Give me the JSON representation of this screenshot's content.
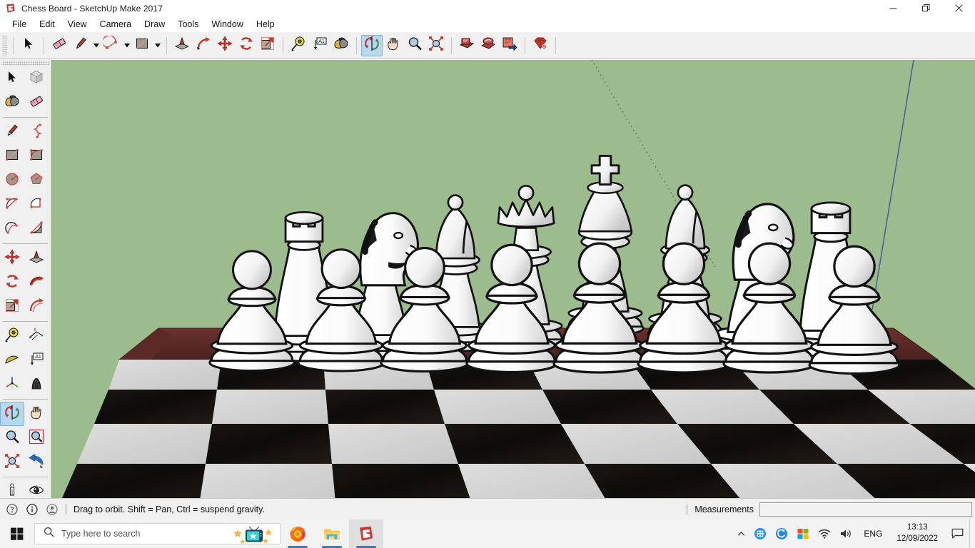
{
  "window": {
    "title": "Chess Board - SketchUp Make 2017",
    "app_icon": "sketchup-logo-icon",
    "controls": {
      "minimize": "─",
      "maximize": "❐",
      "close": "✕"
    }
  },
  "menubar": {
    "items": [
      {
        "label": "File"
      },
      {
        "label": "Edit"
      },
      {
        "label": "View"
      },
      {
        "label": "Camera"
      },
      {
        "label": "Draw"
      },
      {
        "label": "Tools"
      },
      {
        "label": "Window"
      },
      {
        "label": "Help"
      }
    ]
  },
  "toolbar_top": {
    "groups": [
      {
        "buttons": [
          {
            "name": "select-tool",
            "icon": "arrow-cursor-icon",
            "dropdown": false,
            "active": false
          }
        ]
      },
      {
        "buttons": [
          {
            "name": "eraser-tool",
            "icon": "eraser-icon",
            "dropdown": false,
            "active": false
          },
          {
            "name": "line-tool",
            "icon": "pencil-line-icon",
            "dropdown": true,
            "active": false
          },
          {
            "name": "arc-tool",
            "icon": "arc-icon",
            "dropdown": true,
            "active": false
          },
          {
            "name": "rectangle-tool",
            "icon": "rectangle-icon",
            "dropdown": true,
            "active": false
          }
        ]
      },
      {
        "buttons": [
          {
            "name": "pushpull-tool",
            "icon": "push-pull-icon",
            "dropdown": false,
            "active": false
          },
          {
            "name": "followme-tool",
            "icon": "follow-me-icon",
            "dropdown": false,
            "active": false
          },
          {
            "name": "move-tool",
            "icon": "move-arrows-icon",
            "dropdown": false,
            "active": false
          },
          {
            "name": "rotate-tool",
            "icon": "rotate-icon",
            "dropdown": false,
            "active": false
          },
          {
            "name": "scale-tool",
            "icon": "scale-icon",
            "dropdown": false,
            "active": false
          }
        ]
      },
      {
        "buttons": [
          {
            "name": "tape-measure-tool",
            "icon": "tape-measure-icon",
            "dropdown": false,
            "active": false
          },
          {
            "name": "text-tool",
            "icon": "text-label-icon",
            "dropdown": false,
            "active": false
          },
          {
            "name": "paint-bucket-tool",
            "icon": "paint-bucket-icon",
            "dropdown": false,
            "active": false
          }
        ]
      },
      {
        "buttons": [
          {
            "name": "orbit-tool",
            "icon": "orbit-icon",
            "dropdown": false,
            "active": true
          },
          {
            "name": "pan-tool",
            "icon": "hand-pan-icon",
            "dropdown": false,
            "active": false
          },
          {
            "name": "zoom-tool",
            "icon": "magnifier-zoom-icon",
            "dropdown": false,
            "active": false
          },
          {
            "name": "zoom-extents-tool",
            "icon": "zoom-extents-icon",
            "dropdown": false,
            "active": false
          }
        ]
      },
      {
        "buttons": [
          {
            "name": "previous-scene",
            "icon": "scene-previous-icon",
            "dropdown": false,
            "active": false
          },
          {
            "name": "add-scene",
            "icon": "scene-add-icon",
            "dropdown": false,
            "active": false
          },
          {
            "name": "export-scene",
            "icon": "scene-export-icon",
            "dropdown": false,
            "active": false
          }
        ]
      },
      {
        "buttons": [
          {
            "name": "extension-warehouse",
            "icon": "ruby-gem-icon",
            "dropdown": false,
            "active": false
          }
        ]
      }
    ]
  },
  "toolbar_left": {
    "groups": [
      {
        "buttons": [
          {
            "name": "select-tool",
            "icon": "arrow-cursor-icon",
            "active": false
          },
          {
            "name": "make-component-tool",
            "icon": "component-cube-icon",
            "active": false
          },
          {
            "name": "paint-bucket-tool",
            "icon": "paint-bucket-icon",
            "active": false
          },
          {
            "name": "eraser-tool",
            "icon": "eraser-icon",
            "active": false
          }
        ]
      },
      {
        "buttons": [
          {
            "name": "line-tool",
            "icon": "pencil-line-icon",
            "active": false
          },
          {
            "name": "freehand-tool",
            "icon": "freehand-squiggle-icon",
            "active": false
          },
          {
            "name": "rectangle-tool",
            "icon": "rectangle-icon",
            "active": false
          },
          {
            "name": "rotated-rectangle-tool",
            "icon": "rotated-rectangle-icon",
            "active": false
          },
          {
            "name": "circle-tool",
            "icon": "circle-icon",
            "active": false
          },
          {
            "name": "polygon-tool",
            "icon": "polygon-icon",
            "active": false
          },
          {
            "name": "arc-tool",
            "icon": "arc-icon",
            "active": false
          },
          {
            "name": "two-point-arc-tool",
            "icon": "two-point-arc-icon",
            "active": false
          },
          {
            "name": "three-point-arc-tool",
            "icon": "three-point-arc-icon",
            "active": false
          },
          {
            "name": "pie-tool",
            "icon": "pie-icon",
            "active": false
          }
        ]
      },
      {
        "buttons": [
          {
            "name": "move-tool",
            "icon": "move-arrows-icon",
            "active": false
          },
          {
            "name": "pushpull-tool",
            "icon": "push-pull-icon",
            "active": false
          },
          {
            "name": "rotate-tool",
            "icon": "rotate-icon",
            "active": false
          },
          {
            "name": "followme-tool",
            "icon": "follow-me-icon",
            "active": false
          },
          {
            "name": "scale-tool",
            "icon": "scale-icon",
            "active": false
          },
          {
            "name": "offset-tool",
            "icon": "offset-icon",
            "active": false
          }
        ]
      },
      {
        "buttons": [
          {
            "name": "tape-measure-tool",
            "icon": "tape-measure-icon",
            "active": false
          },
          {
            "name": "dimension-tool",
            "icon": "dimension-icon",
            "active": false
          },
          {
            "name": "protractor-tool",
            "icon": "protractor-icon",
            "active": false
          },
          {
            "name": "text-tool",
            "icon": "text-label-icon",
            "active": false
          },
          {
            "name": "axes-tool",
            "icon": "axes-icon",
            "active": false
          },
          {
            "name": "three-d-text-tool",
            "icon": "three-d-text-icon",
            "active": false
          }
        ]
      },
      {
        "buttons": [
          {
            "name": "orbit-tool",
            "icon": "orbit-icon",
            "active": true
          },
          {
            "name": "pan-tool",
            "icon": "hand-pan-icon",
            "active": false
          },
          {
            "name": "zoom-tool",
            "icon": "magnifier-zoom-icon",
            "active": false
          },
          {
            "name": "zoom-window-tool",
            "icon": "zoom-window-icon",
            "active": false
          },
          {
            "name": "zoom-extents-tool",
            "icon": "zoom-extents-icon",
            "active": false
          },
          {
            "name": "previous-view-tool",
            "icon": "previous-view-icon",
            "active": false
          }
        ]
      },
      {
        "buttons": [
          {
            "name": "position-camera-tool",
            "icon": "position-camera-person-icon",
            "active": false
          },
          {
            "name": "look-around-tool",
            "icon": "eye-look-around-icon",
            "active": false
          }
        ]
      }
    ]
  },
  "statusbar": {
    "icons": [
      {
        "name": "help-info-icon"
      },
      {
        "name": "about-info-icon"
      },
      {
        "name": "user-account-icon"
      }
    ],
    "hint": "Drag to orbit. Shift = Pan, Ctrl = suspend gravity.",
    "measurements_label": "Measurements",
    "measurements_value": "",
    "measurements_placeholder": ""
  },
  "scene": {
    "name": "chess-board-3d-model",
    "background_color": "#9cbc8e",
    "board_edge_color": "#5c2a28",
    "light_square_color": "#d4d4d4",
    "dark_square_color": "#15120f",
    "piece_color": "#ffffff",
    "green_axis_color": "#3d7a3d",
    "blue_axis_color": "#3a55a0",
    "board_rows": 8,
    "board_cols": 8,
    "back_rank_pieces": [
      "rook",
      "knight",
      "bishop",
      "queen",
      "king",
      "bishop",
      "knight",
      "rook"
    ],
    "front_rank_pieces": [
      "pawn",
      "pawn",
      "pawn",
      "pawn",
      "pawn",
      "pawn",
      "pawn",
      "pawn"
    ]
  },
  "taskbar": {
    "start_label": "start-button",
    "search_placeholder": "Type here to search",
    "search_value": "",
    "search_widget_icon": "news-tv-stars-icon",
    "apps": [
      {
        "name": "firefox-taskbar-icon",
        "label": "Firefox",
        "running": true,
        "focused": false
      },
      {
        "name": "file-explorer-taskbar-icon",
        "label": "File Explorer",
        "running": true,
        "focused": false
      },
      {
        "name": "sketchup-taskbar-icon",
        "label": "SketchUp",
        "running": true,
        "focused": true
      }
    ],
    "tray": {
      "chevron": "∧",
      "items": [
        {
          "name": "onedrive-tray-icon"
        },
        {
          "name": "antivirus-tray-icon"
        },
        {
          "name": "windows-security-tray-icon"
        },
        {
          "name": "wifi-tray-icon"
        },
        {
          "name": "volume-tray-icon"
        }
      ],
      "language": "ENG",
      "time": "13:13",
      "date": "12/09/2022",
      "action_center_icon": "notification-chat-icon"
    }
  }
}
